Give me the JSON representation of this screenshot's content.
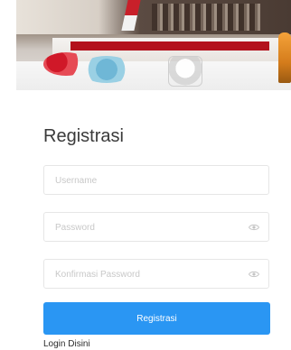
{
  "form": {
    "title": "Registrasi",
    "username": {
      "placeholder": "Username",
      "value": ""
    },
    "password": {
      "placeholder": "Password",
      "value": "",
      "icon": "eye-icon"
    },
    "confirm_password": {
      "placeholder": "Konfirmasi Password",
      "value": "",
      "icon": "eye-icon"
    },
    "submit_label": "Registrasi",
    "login_link": "Login Disini"
  },
  "colors": {
    "primary": "#2a96f3",
    "border": "#e6e6e6",
    "placeholder": "#c8c8c8",
    "title": "#3a3a3a"
  }
}
